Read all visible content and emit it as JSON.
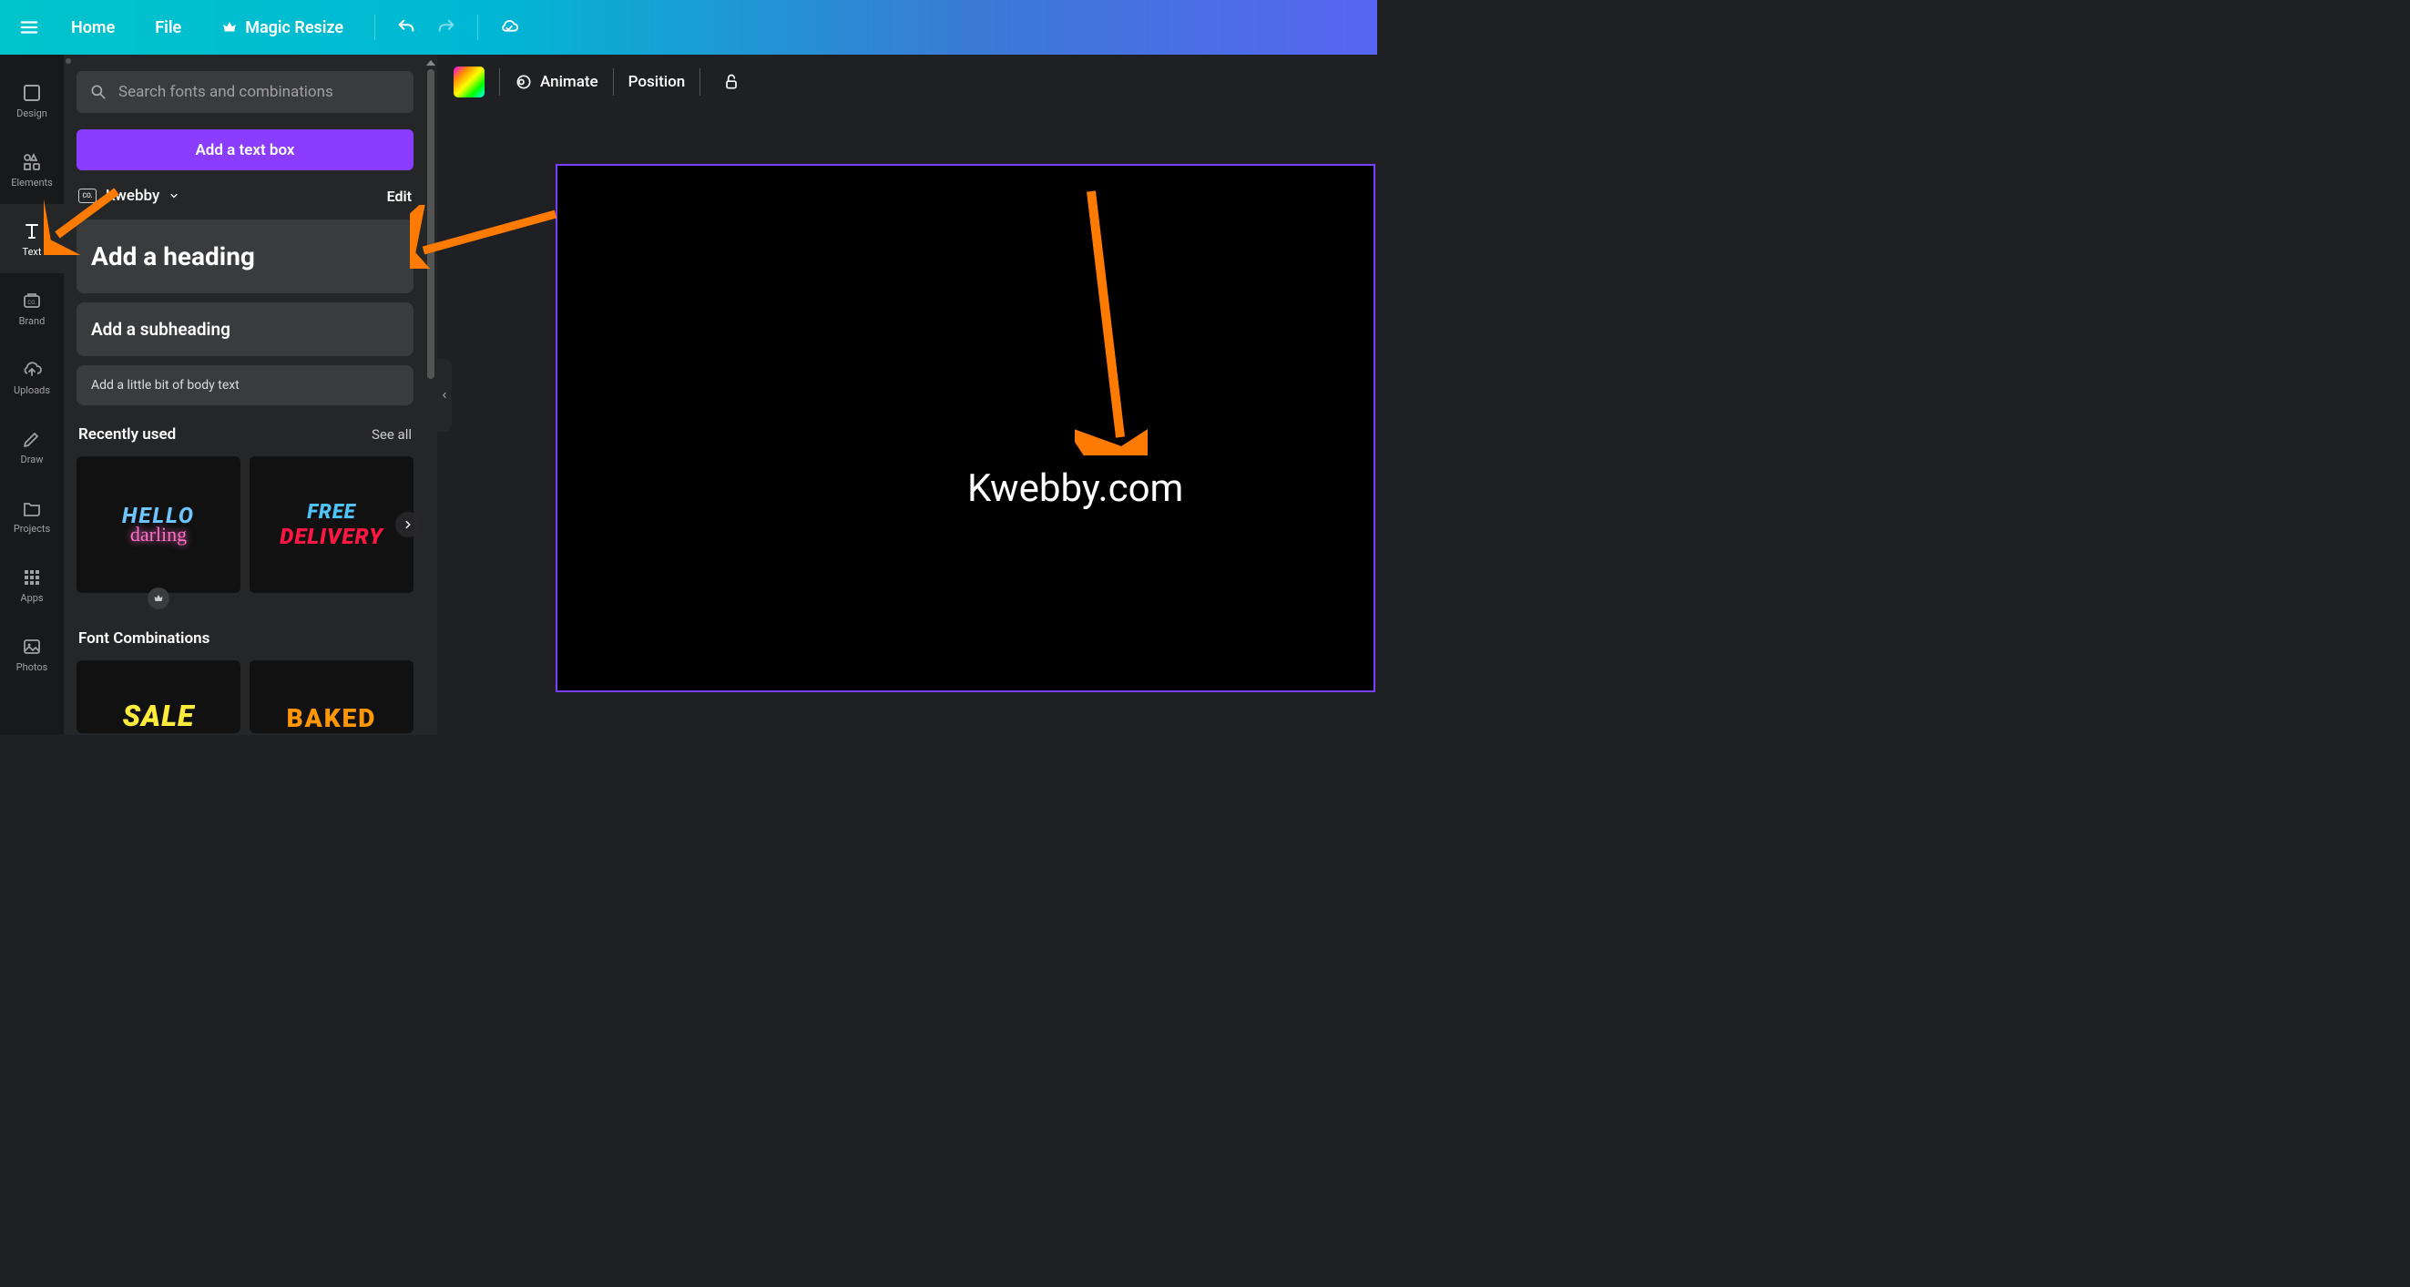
{
  "topbar": {
    "home": "Home",
    "file": "File",
    "magic_resize": "Magic Resize"
  },
  "rail": {
    "design": "Design",
    "elements": "Elements",
    "text": "Text",
    "brand": "Brand",
    "uploads": "Uploads",
    "draw": "Draw",
    "projects": "Projects",
    "apps": "Apps",
    "photos": "Photos"
  },
  "panel": {
    "search_placeholder": "Search fonts and combinations",
    "add_text_box": "Add a text box",
    "brand_name": "Kwebby",
    "edit": "Edit",
    "heading": "Add a heading",
    "subheading": "Add a subheading",
    "body_text": "Add a little bit of body text",
    "recently_used": "Recently used",
    "see_all": "See all",
    "font_combinations": "Font Combinations",
    "tiles": {
      "hello_line1": "HELLO",
      "hello_line2": "darling",
      "free_line1": "FREE",
      "free_line2": "DELIVERY",
      "sale": "SALE",
      "baked": "BAKED"
    }
  },
  "context": {
    "animate": "Animate",
    "position": "Position"
  },
  "canvas": {
    "text": "Kwebby.com"
  }
}
